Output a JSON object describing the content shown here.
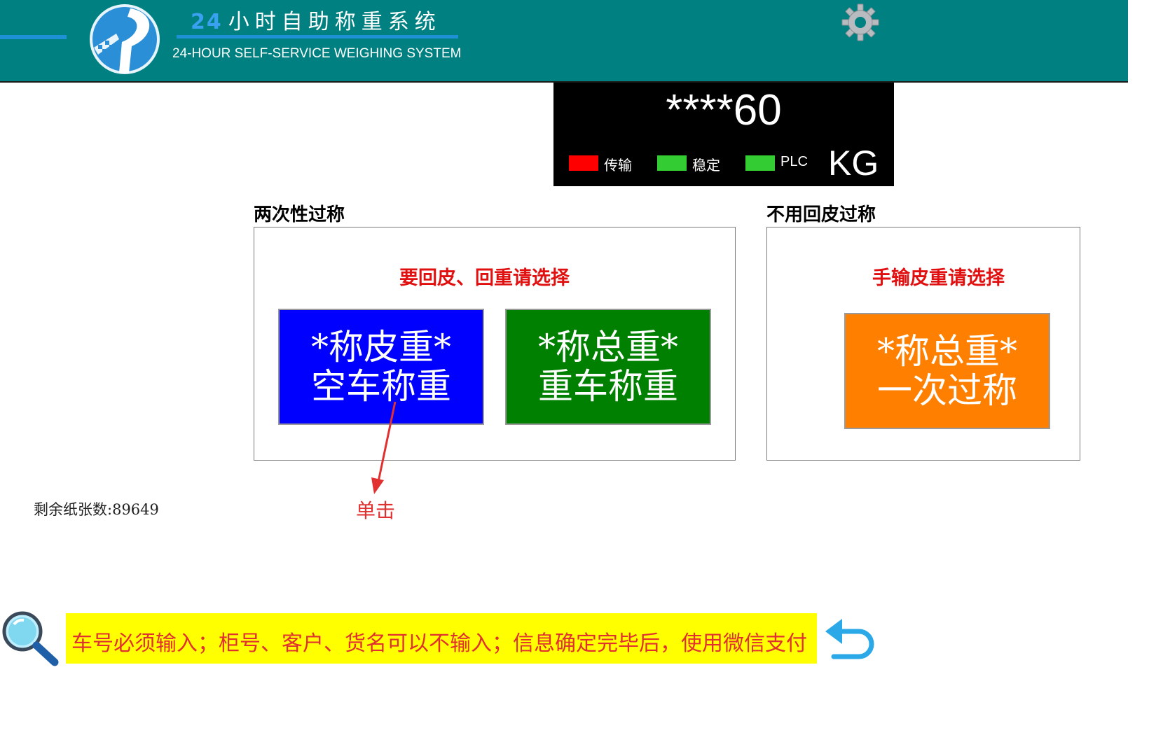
{
  "header": {
    "title_number": "24",
    "title_cn": "小时自助称重系统",
    "title_en": "24-HOUR SELF-SERVICE WEIGHING SYSTEM",
    "logo_icon": "road-logo-icon",
    "settings_icon": "gear-icon"
  },
  "display": {
    "weight": "****60",
    "unit": "KG",
    "indicators": [
      {
        "label": "传输",
        "color": "#ff0000"
      },
      {
        "label": "稳定",
        "color": "#33cc33"
      },
      {
        "label": "PLC",
        "color": "#33cc33"
      }
    ]
  },
  "two_pass": {
    "title": "两次性过称",
    "prompt": "要回皮、回重请选择",
    "tare_button": {
      "line1": "*称皮重*",
      "line2": "空车称重",
      "color": "#0000ff"
    },
    "gross_button": {
      "line1": "*称总重*",
      "line2": "重车称重",
      "color": "#008000"
    }
  },
  "no_tare": {
    "title": "不用回皮过称",
    "prompt": "手输皮重请选择",
    "gross_button": {
      "line1": "*称总重*",
      "line2": "一次过称",
      "color": "#ff8000"
    }
  },
  "annotation": {
    "click_label": "单击"
  },
  "paper_count": {
    "label": "剩余纸张数:",
    "value": "89649"
  },
  "notice": {
    "text": "车号必须输入；柜号、客户、货名可以不输入；信息确定完毕后，使用微信支付",
    "search_icon": "magnifier-icon",
    "back_icon": "back-arrow-icon"
  }
}
